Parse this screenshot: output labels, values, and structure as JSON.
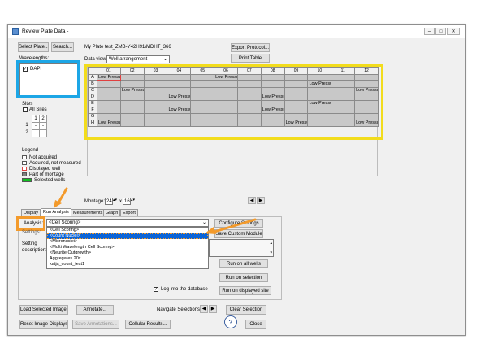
{
  "window": {
    "title": "Review Plate Data -",
    "controls": {
      "minimize": "–",
      "maximize": "□",
      "close": "✕"
    }
  },
  "toolbar": {
    "select_plate": "Select Plate...",
    "search": "Search...",
    "plate_info": "My Plate test_ZMB-Y42H91\\MDHT_366",
    "export_protocol": "Export Protocol...",
    "print_table": "Print Table",
    "data_view_label": "Data view:",
    "data_view_value": "Well arrangement"
  },
  "wavelengths": {
    "label": "Wavelengths:",
    "items": [
      {
        "label": "DAPI",
        "checked": true
      }
    ]
  },
  "sites": {
    "label": "Sites",
    "all_sites": "All Sites",
    "col_headers": [
      "1",
      "2"
    ],
    "rows": [
      {
        "label": "1",
        "cells": [
          "-",
          "-"
        ]
      },
      {
        "label": "2",
        "cells": [
          "-",
          "-"
        ]
      }
    ]
  },
  "legend": {
    "title": "Legend",
    "items": [
      {
        "label": "Not acquired",
        "color": "#ffffff"
      },
      {
        "label": "Acquired, not measured",
        "color": "#ffffff"
      },
      {
        "label": "Displayed well",
        "color": "#ffffff"
      },
      {
        "label": "Part of montage",
        "color": "#808080"
      },
      {
        "label": "Selected wells",
        "color": "#10c020"
      }
    ]
  },
  "plate": {
    "columns": [
      "01",
      "02",
      "03",
      "04",
      "05",
      "06",
      "07",
      "08",
      "09",
      "10",
      "11",
      "12"
    ],
    "rows": [
      {
        "label": "A",
        "cells": {
          "0": "Low Pressure",
          "5": "Low Pressure"
        }
      },
      {
        "label": "B",
        "cells": {
          "9": "Low Pressure"
        }
      },
      {
        "label": "C",
        "cells": {
          "1": "Low Pressure",
          "11": "Low Pressure"
        }
      },
      {
        "label": "D",
        "cells": {
          "3": "Low Pressure",
          "7": "Low Pressure"
        }
      },
      {
        "label": "E",
        "cells": {
          "9": "Low Pressure"
        }
      },
      {
        "label": "F",
        "cells": {
          "3": "Low Pressure",
          "7": "Low Pressure"
        }
      },
      {
        "label": "G",
        "cells": {}
      },
      {
        "label": "H",
        "cells": {
          "0": "Low Pressure",
          "8": "Low Pressure",
          "11": "Low Pressure"
        }
      }
    ]
  },
  "montage": {
    "label": "Montage:",
    "x": "24",
    "by": "x",
    "y": "16"
  },
  "tabs": [
    "Display",
    "Run Analysis",
    "Measurements",
    "Graph",
    "Export"
  ],
  "analysis": {
    "label": "Analysis:",
    "selected": "<Cell Scoring>",
    "options": [
      "<Cell Scoring>",
      "<Count Nuclei>",
      "<Micronuclei>",
      "<Multi Wavelength Cell Scoring>",
      "<Neurite Outgrowth>",
      "Aggregates 20x",
      "katja_count_test1"
    ],
    "highlighted_index": 1,
    "settings_label": "Settings:",
    "setting_label": "Setting",
    "description_label": "description:",
    "configure_settings": "Configure Settings",
    "save_custom_module": "Save Custom Module",
    "run_all": "Run on all wells",
    "run_selection": "Run on selection",
    "run_displayed": "Run on displayed site",
    "log_db": "Log into the database",
    "log_db_checked": true
  },
  "bottom": {
    "load_selected": "Load Selected Images",
    "annotate": "Annotate...",
    "navigate": "Navigate Selections",
    "clear_selection": "Clear Selection",
    "reset_displays": "Reset Image Displays",
    "save_annotations": "Save Annotations...",
    "cellular_results": "Cellular Results...",
    "help": "?",
    "close": "Close"
  },
  "colors": {
    "highlight_blue": "#1ca6e6",
    "highlight_yellow": "#f2dc1c",
    "highlight_orange": "#f39a2b",
    "selection_blue": "#0a64d8"
  }
}
